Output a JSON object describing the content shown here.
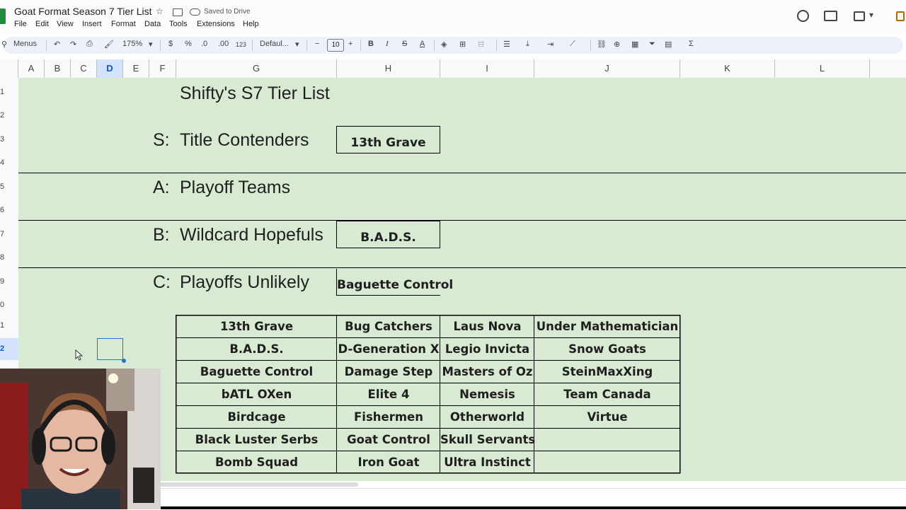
{
  "app": {
    "doc_title": "Goat Format Season 7 Tier List",
    "saved_status": "Saved to Drive",
    "menu": [
      "File",
      "Edit",
      "View",
      "Insert",
      "Format",
      "Data",
      "Tools",
      "Extensions",
      "Help"
    ]
  },
  "toolbar": {
    "search_label": "Menus",
    "zoom": "175%",
    "currency": "$",
    "percent": "%",
    "decimal_decrease": ".0",
    "decimal_increase": ".00",
    "number_format": "123",
    "font": "Defaul...",
    "minus": "−",
    "font_size": "10",
    "plus": "+",
    "bold": "B",
    "italic": "I",
    "strikethrough": "S",
    "text_color": "A",
    "sigma": "Σ"
  },
  "columns": [
    "A",
    "B",
    "C",
    "D",
    "E",
    "F",
    "G",
    "H",
    "I",
    "J",
    "K",
    "L"
  ],
  "rows": [
    "1",
    "2",
    "3",
    "4",
    "5",
    "6",
    "7",
    "8",
    "9",
    "0",
    "1",
    "2"
  ],
  "sheet": {
    "title": "Shifty's S7 Tier List",
    "tiers": [
      {
        "letter": "S:",
        "label": "Title Contenders",
        "team": "13th Grave"
      },
      {
        "letter": "A:",
        "label": "Playoff Teams",
        "team": ""
      },
      {
        "letter": "B:",
        "label": "Wildcard Hopefuls",
        "team": "B.A.D.S."
      },
      {
        "letter": "C:",
        "label": "Playoffs Unlikely",
        "team": "Baguette Control"
      }
    ],
    "team_columns": [
      [
        "13th Grave",
        "B.A.D.S.",
        "Baguette Control",
        "bATL OXen",
        "Birdcage",
        "Black Luster Serbs",
        "Bomb Squad"
      ],
      [
        "Bug Catchers",
        "D-Generation X",
        "Damage Step",
        "Elite 4",
        "Fishermen",
        "Goat Control",
        "Iron Goat"
      ],
      [
        "Laus Nova",
        "Legio Invicta",
        "Masters of Oz",
        "Nemesis",
        "Otherworld",
        "Skull Servants",
        "Ultra Instinct"
      ],
      [
        "Under Mathematician",
        "Snow Goats",
        "SteinMaxXing",
        "Team Canada",
        "Virtue",
        "",
        ""
      ]
    ]
  },
  "colors": {
    "sheet_bg": "#d9ead3",
    "selection": "#1a73e8",
    "logo": "#1e8e3e"
  }
}
